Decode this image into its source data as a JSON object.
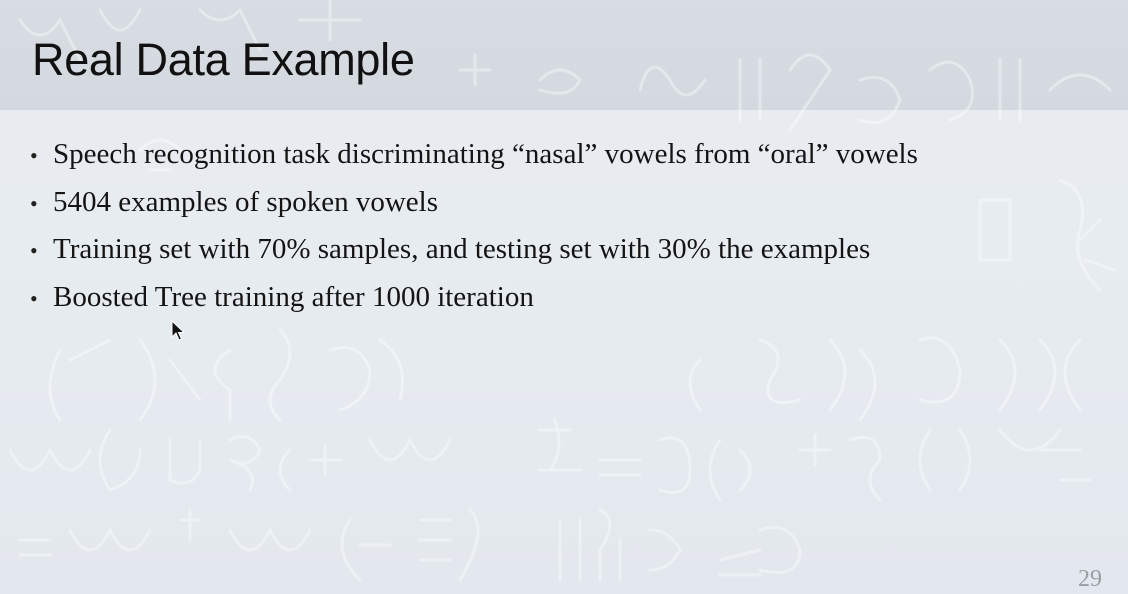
{
  "slide": {
    "title": "Real Data Example",
    "bullet_glyph": "•",
    "bullets": [
      "Speech recognition task discriminating “nasal” vowels from “oral” vowels",
      "5404 examples of spoken vowels",
      "Training set with 70% samples, and testing set with 30% the examples",
      "Boosted Tree training after 1000 iteration"
    ],
    "page_number": "29"
  },
  "icons": {
    "cursor": "mouse-pointer-icon"
  },
  "colors": {
    "title_band": "#d5dbe1",
    "background": "#e7ecf1",
    "text": "#141414",
    "page_number": "#9a9ea3"
  }
}
